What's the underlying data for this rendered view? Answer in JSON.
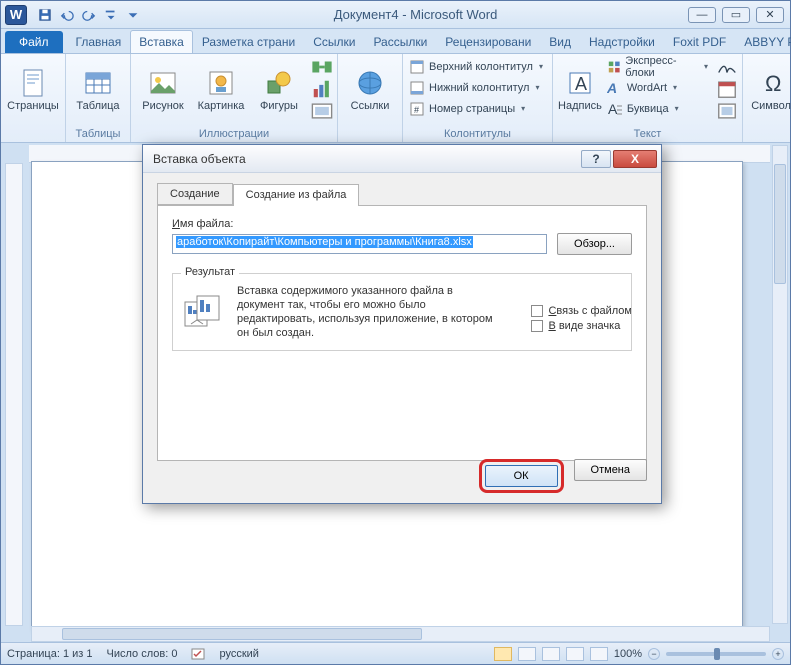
{
  "window": {
    "title": "Документ4 - Microsoft Word",
    "app_letter": "W"
  },
  "ribbon": {
    "file": "Файл",
    "tabs": [
      "Главная",
      "Вставка",
      "Разметка страни",
      "Ссылки",
      "Рассылки",
      "Рецензировани",
      "Вид",
      "Надстройки",
      "Foxit PDF",
      "ABBYY PDF Trans"
    ],
    "active_tab_index": 1,
    "groups": {
      "pages": {
        "btn": "Страницы",
        "label": ""
      },
      "tables": {
        "btn": "Таблица",
        "label": "Таблицы"
      },
      "illustr": {
        "buttons": [
          "Рисунок",
          "Картинка",
          "Фигуры"
        ],
        "label": "Иллюстрации"
      },
      "links": {
        "btn": "Ссылки",
        "label": ""
      },
      "header": {
        "items": [
          "Верхний колонтитул",
          "Нижний колонтитул",
          "Номер страницы"
        ],
        "label": "Колонтитулы"
      },
      "textgrp": {
        "btn": "Надпись",
        "items": [
          "Экспресс-блоки",
          "WordArt",
          "Буквица"
        ],
        "label": "Текст"
      },
      "symbols": {
        "btn": "Символы",
        "label": ""
      }
    }
  },
  "statusbar": {
    "page": "Страница: 1 из 1",
    "words": "Число слов: 0",
    "lang": "русский",
    "zoom": "100%"
  },
  "dialog": {
    "title": "Вставка объекта",
    "tab_create": "Создание",
    "tab_from_file": "Создание из файла",
    "file_label_pre": "И",
    "file_label_rest": "мя файла:",
    "file_value": "аработок\\Копирайт\\Компьютеры и программы\\Книга8.xlsx",
    "browse": "Обзор...",
    "link_pre": "С",
    "link_rest": "вязь с файлом",
    "asicon_pre": "В",
    "asicon_rest": " виде значка",
    "result_legend": "Результат",
    "result_text": "Вставка содержимого указанного файла в документ так, чтобы его можно было редактировать, используя приложение, в котором он был создан.",
    "ok": "ОК",
    "cancel": "Отмена"
  }
}
